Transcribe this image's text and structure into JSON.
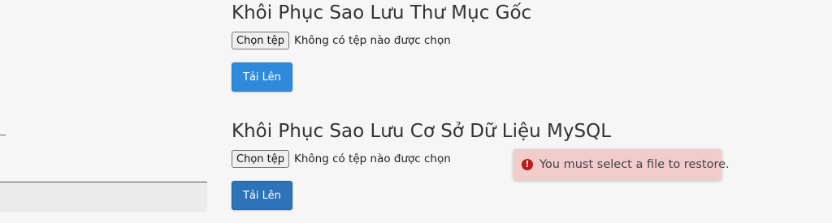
{
  "sections": [
    {
      "title": "Khôi Phục Sao Lưu Thư Mục Gốc",
      "choose_file_label": "Chọn tệp",
      "file_status": "Không có tệp nào được chọn",
      "upload_label": "Tải Lên"
    },
    {
      "title": "Khôi Phục Sao Lưu Cơ Sở Dữ Liệu MySQL",
      "choose_file_label": "Chọn tệp",
      "file_status": "Không có tệp nào được chọn",
      "upload_label": "Tải Lên"
    }
  ],
  "alert": {
    "icon": "error-icon",
    "glyph": "!",
    "message": "You must select a file to restore."
  },
  "colors": {
    "upload_button": "#2f8adb",
    "alert_background": "#f2cbcb",
    "alert_icon": "#b81c1c"
  }
}
